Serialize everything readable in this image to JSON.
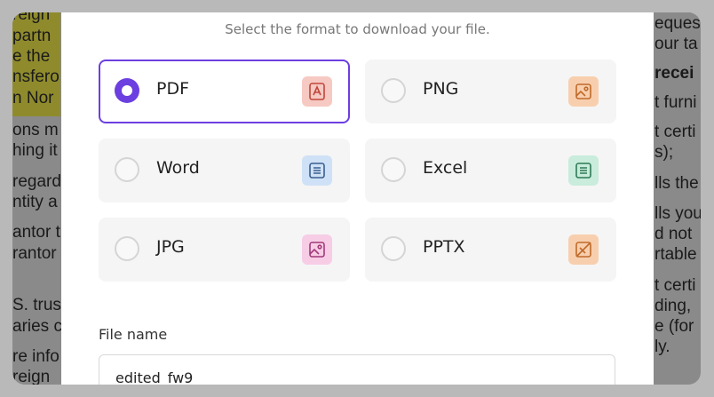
{
  "document": {
    "left_lines": [
      "reign",
      "partn",
      "e the",
      "nsfero",
      "n Nor",
      "ons m",
      "hing it",
      "regard",
      "ntity a",
      "antor t",
      "rantor",
      "S. trus",
      "aries c",
      "re info",
      "reign"
    ],
    "right_lines": [
      "eques",
      "our ta",
      "recei",
      "t furni",
      "t certi",
      "s);",
      "lls the",
      "lls you",
      "d not",
      "rtable",
      "t certi",
      "ding,",
      "e (for",
      "ly."
    ]
  },
  "dialog": {
    "subtitle": "Select the format to download your file.",
    "formats": [
      {
        "label": "PDF",
        "selected": true,
        "icon": "pdf-icon",
        "icon_bg": "#f6c9c3",
        "icon_color": "#c0473a"
      },
      {
        "label": "PNG",
        "selected": false,
        "icon": "image-icon",
        "icon_bg": "#f8cfae",
        "icon_color": "#c06a2a"
      },
      {
        "label": "Word",
        "selected": false,
        "icon": "document-icon",
        "icon_bg": "#cfe1f6",
        "icon_color": "#3a5f8f"
      },
      {
        "label": "Excel",
        "selected": false,
        "icon": "spreadsheet-icon",
        "icon_bg": "#c9ecdc",
        "icon_color": "#2f7a55"
      },
      {
        "label": "JPG",
        "selected": false,
        "icon": "image-icon",
        "icon_bg": "#f7cde6",
        "icon_color": "#a13b7a"
      },
      {
        "label": "PPTX",
        "selected": false,
        "icon": "presentation-icon",
        "icon_bg": "#f8cfae",
        "icon_color": "#c06a2a"
      }
    ],
    "file_name": {
      "label": "File name",
      "value": "edited_fw9"
    },
    "accent_color": "#6c3fe0"
  }
}
